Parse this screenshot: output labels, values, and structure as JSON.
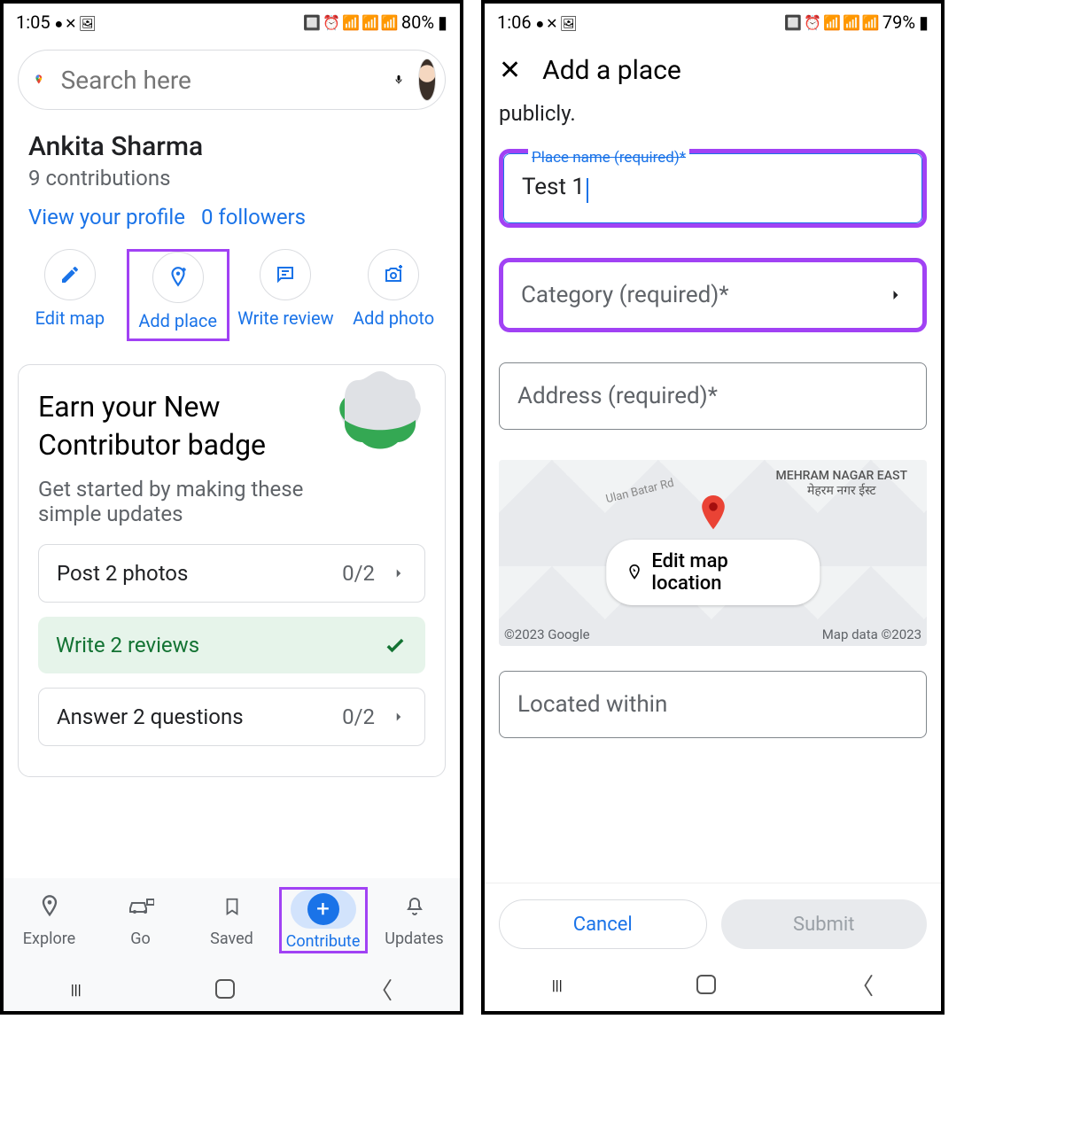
{
  "phone1": {
    "status": {
      "time": "1:05",
      "battery": "80%"
    },
    "search": {
      "placeholder": "Search here"
    },
    "profile": {
      "name": "Ankita Sharma",
      "contributions": "9 contributions",
      "view_profile": "View your profile",
      "followers": "0 followers"
    },
    "actions": {
      "edit_map": "Edit map",
      "add_place": "Add place",
      "write_review": "Write review",
      "add_photo": "Add photo"
    },
    "badge_card": {
      "title": "Earn your New Contributor badge",
      "subtitle": "Get started by making these simple updates",
      "task1_label": "Post 2 photos",
      "task1_progress": "0/2",
      "task2_label": "Write 2 reviews",
      "task3_label": "Answer 2 questions",
      "task3_progress": "0/2"
    },
    "nav": {
      "explore": "Explore",
      "go": "Go",
      "saved": "Saved",
      "contribute": "Contribute",
      "updates": "Updates"
    }
  },
  "phone2": {
    "status": {
      "time": "1:06",
      "battery": "79%"
    },
    "header": {
      "title": "Add a place"
    },
    "body": {
      "publicly": "publicly.",
      "place_name_label": "Place name (required)*",
      "place_name_value": "Test 1",
      "category_label": "Category (required)*",
      "address_label": "Address (required)*",
      "edit_map_location": "Edit map location",
      "map_area_name": "MEHRAM NAGAR EAST",
      "map_area_sub": "मेहरम नगर ईस्ट",
      "road_name": "Ulan Batar Rd",
      "map_attr_left": "©2023 Google",
      "map_attr_right": "Map data ©2023",
      "located_within": "Located within"
    },
    "footer": {
      "cancel": "Cancel",
      "submit": "Submit"
    }
  }
}
